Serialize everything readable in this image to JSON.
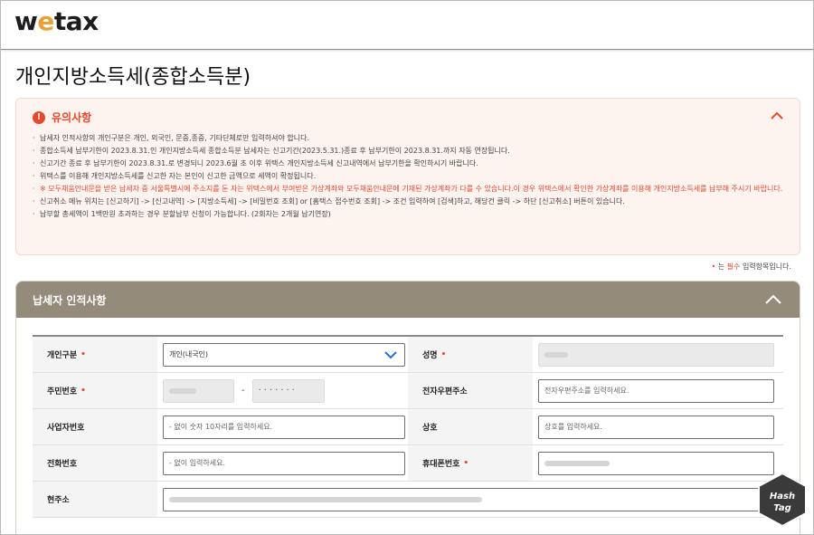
{
  "header": {
    "logo_prefix": "w",
    "logo_e": "e",
    "logo_suffix": "tax"
  },
  "page": {
    "title": "개인지방소득세(종합소득분)"
  },
  "notice": {
    "title": "유의사항",
    "items": [
      "납세자 인적사항의 개인구분은 개인, 외국인, 문중,종중, 기타단체로만 입력하셔야 합니다.",
      "종합소득세 납부기한이 2023.8.31.인 개인지방소득세 종합소득분 납세자는 신고기간(2023.5.31.)종료 후 납부기한이 2023.8.31.까지 자동 연장됩니다.",
      "신고기간 종료 후 납부기한이 2023.8.31.로 변경되니 2023.6월 초 이후 위택스 개인지방소득세 신고내역에서 납부기한을 확인하시기 바랍니다.",
      "위택스를 이용해 개인지방소득세를 신고한 자는 본인이 신고한 금액으로 세액이 확정됩니다.",
      "※ 모두채움안내문을 받은 납세자 중 서울특별시에 주소지를 둔 자는 위택스에서 부여받은 가상계좌와 모두채움안내문에 기재된 가상계좌가 다를 수 있습니다.이 경우 위택스에서 확인한 가상계좌를 이용해 개인지방소득세를 납부해 주시기 바랍니다.",
      "신고취소 메뉴 위치는 [신고하기] -> [신고내역] -> [지방소득세] -> [비밀번호 조회] or [홈택스 접수번호 조회] -> 조건 입력하여 [검색]하고, 해당건 클릭 -> 하단 [신고취소] 버튼이 있습니다.",
      "납부할 총세액이 1백만원 초과하는 경우 분할납부 신청이 가능합니다. (2회차는 2개월 납기연장)"
    ]
  },
  "required_note": {
    "star": "•",
    "prefix": "는",
    "emphasis": "필수",
    "suffix": "입력항목입니다."
  },
  "panel": {
    "title": "납세자 인적사항",
    "fields": {
      "type_label": "개인구분",
      "type_value": "개인(내국인)",
      "name_label": "성명",
      "rrn_label": "주민번호",
      "rrn_dash": "-",
      "rrn_back_mask": "·······",
      "email_label": "전자우편주소",
      "email_placeholder": "전자우편주소를 입력하세요.",
      "bizno_label": "사업자번호",
      "bizno_placeholder": "- 없이 숫자 10자리를 입력하세요.",
      "company_label": "상호",
      "company_placeholder": "상호를 입력하세요.",
      "phone_label": "전화번호",
      "phone_placeholder": "- 없이 입력하세요.",
      "mobile_label": "휴대폰번호",
      "address_label": "현주소",
      "required_mark": "•"
    }
  },
  "watermark": {
    "line1": "Hash",
    "line2": "Tag"
  },
  "colors": {
    "accent": "#e8492b",
    "panel_header": "#958b7b",
    "notice_bg": "#fdf3ef",
    "select_chevron": "#2d6bd8"
  }
}
